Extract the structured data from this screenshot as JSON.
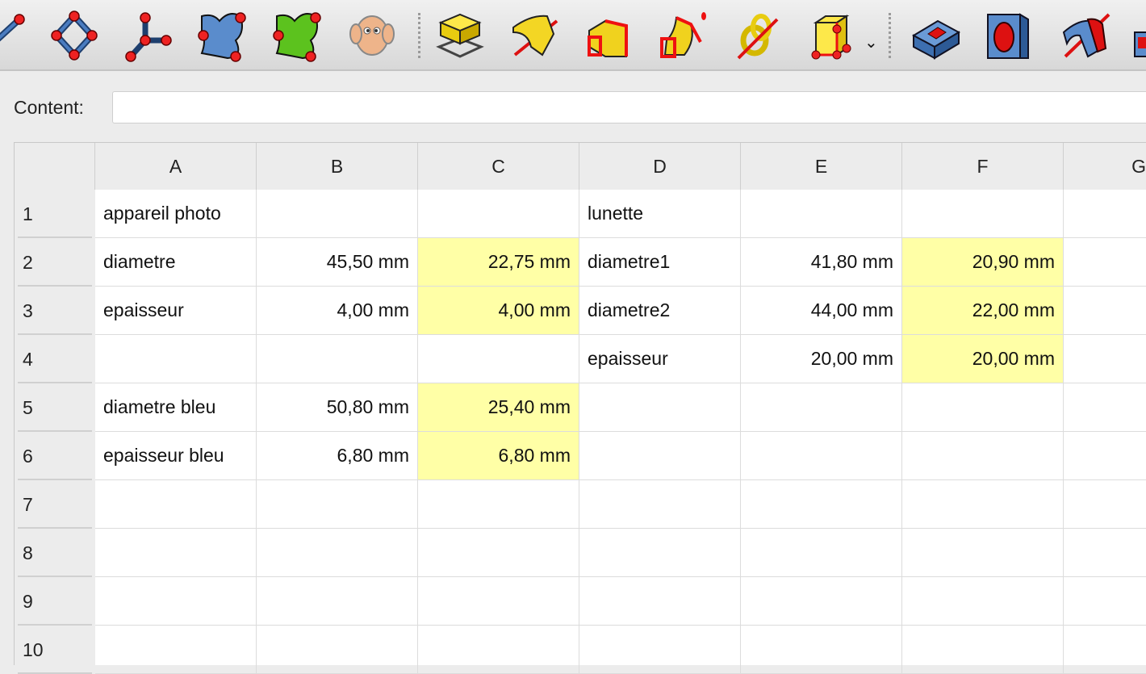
{
  "toolbar": {
    "icons": [
      "sketch-line-icon",
      "sketch-polygon-icon",
      "sketch-wire-icon",
      "face-blue-icon",
      "face-green-icon",
      "sheep-icon",
      "extrude-icon",
      "revolve-icon",
      "loft-icon",
      "sweep-icon",
      "helix-icon",
      "primitives-icon",
      "pocket-icon",
      "hole-icon",
      "groove-icon",
      "subtractive-icon"
    ]
  },
  "content": {
    "label": "Content:",
    "value": ""
  },
  "colors": {
    "highlight": "#ffffa6"
  },
  "sheet": {
    "columns": [
      "A",
      "B",
      "C",
      "D",
      "E",
      "F",
      "G"
    ],
    "rows": [
      "1",
      "2",
      "3",
      "4",
      "5",
      "6",
      "7",
      "8",
      "9",
      "10"
    ],
    "cells": [
      [
        "appareil photo",
        "",
        "",
        "lunette",
        "",
        "",
        ""
      ],
      [
        "diametre",
        "45,50 mm",
        "22,75 mm",
        "diametre1",
        "41,80 mm",
        "20,90 mm",
        ""
      ],
      [
        "epaisseur",
        "4,00 mm",
        "4,00 mm",
        "diametre2",
        "44,00 mm",
        "22,00 mm",
        ""
      ],
      [
        "",
        "",
        "",
        "epaisseur",
        "20,00 mm",
        "20,00 mm",
        ""
      ],
      [
        "diametre bleu",
        "50,80 mm",
        "25,40 mm",
        "",
        "",
        "",
        ""
      ],
      [
        "epaisseur bleu",
        "6,80 mm",
        "6,80 mm",
        "",
        "",
        "",
        ""
      ],
      [
        "",
        "",
        "",
        "",
        "",
        "",
        ""
      ],
      [
        "",
        "",
        "",
        "",
        "",
        "",
        ""
      ],
      [
        "",
        "",
        "",
        "",
        "",
        "",
        ""
      ],
      [
        "",
        "",
        "",
        "",
        "",
        "",
        ""
      ]
    ],
    "highlighted": [
      "C2",
      "C3",
      "C5",
      "C6",
      "F2",
      "F3",
      "F4"
    ]
  }
}
